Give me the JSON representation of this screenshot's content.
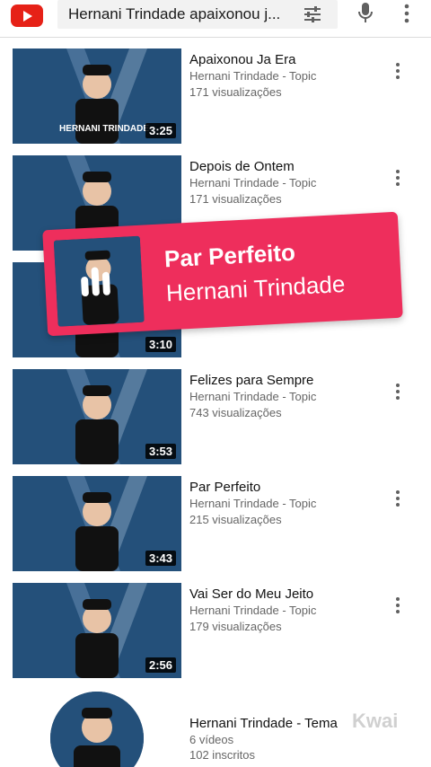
{
  "search": {
    "query": "Hernani Trindade apaixonou j..."
  },
  "icons": {
    "logo": "youtube-logo-icon",
    "filter": "filter-sliders-icon",
    "mic": "microphone-icon",
    "more": "more-vert-icon"
  },
  "colors": {
    "brand_red": "#e62117",
    "card_pink": "#ee2e5c",
    "meta_gray": "#666666"
  },
  "videos": [
    {
      "title": "Apaixonou Ja Era",
      "channel": "Hernani Trindade - Topic",
      "views": "171 visualizações",
      "duration": "3:25"
    },
    {
      "title": "Depois de Ontem",
      "channel": "Hernani Trindade - Topic",
      "views": "171 visualizações",
      "duration": ""
    },
    {
      "title": "",
      "channel": "",
      "views": "",
      "duration": "3:10"
    },
    {
      "title": "Felizes para Sempre",
      "channel": "Hernani Trindade - Topic",
      "views": "743 visualizações",
      "duration": "3:53"
    },
    {
      "title": "Par Perfeito",
      "channel": "Hernani Trindade - Topic",
      "views": "215 visualizações",
      "duration": "3:43"
    },
    {
      "title": "Vai Ser do Meu Jeito",
      "channel": "Hernani Trindade - Topic",
      "views": "179 visualizações",
      "duration": "2:56"
    }
  ],
  "playlist": {
    "title": "Hernani Trindade - Tema",
    "videos": "6 vídeos",
    "subscribers": "102 inscritos"
  },
  "now_playing": {
    "title": "Par Perfeito",
    "artist": "Hernani Trindade"
  },
  "thumbnail_text": "HERNANI TRINDADE",
  "watermark": "Kwai"
}
